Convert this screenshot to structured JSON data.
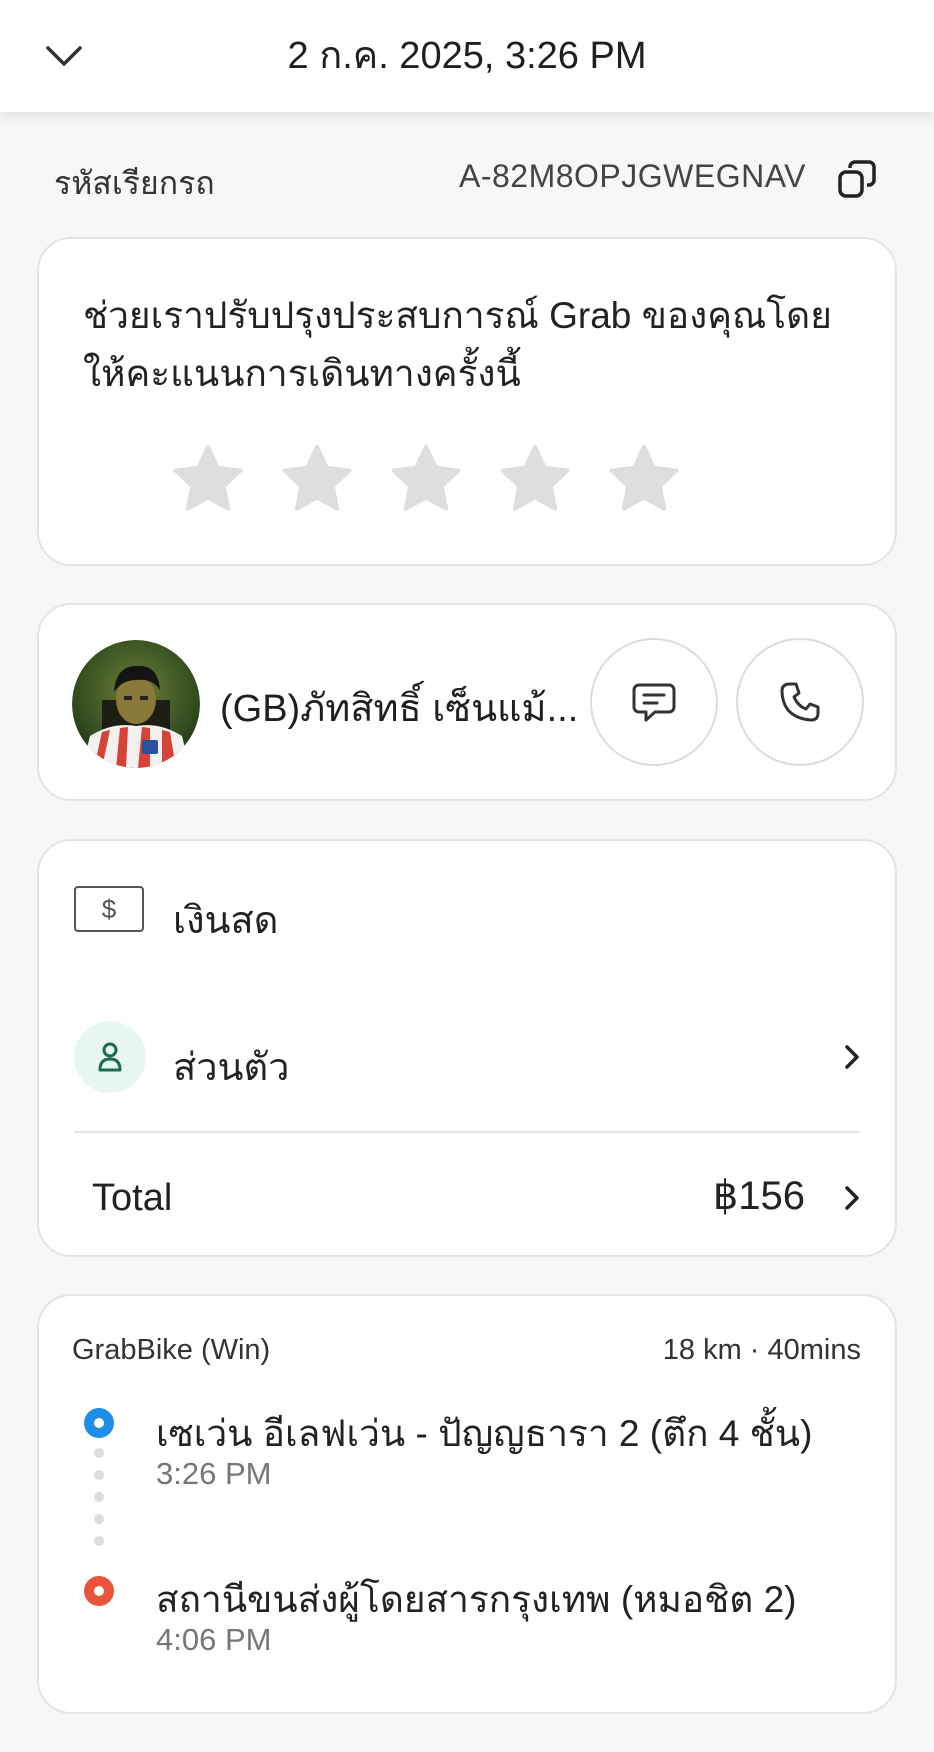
{
  "header": {
    "title": "2 ก.ค. 2025, 3:26 PM"
  },
  "booking": {
    "label": "รหัสเรียกรถ",
    "code": "A-82M8OPJGWEGNAV"
  },
  "rating": {
    "prompt": "ช่วยเราปรับปรุงประสบการณ์ Grab ของคุณโดยให้คะแนนการเดินทางครั้งนี้",
    "stars_total": 5,
    "stars_selected": 0
  },
  "driver": {
    "name": "(GB)ภัทสิทธิ์ เซ็นแม้..."
  },
  "payment": {
    "method": "เงินสด",
    "cash_symbol": "$",
    "profile": "ส่วนตัว",
    "total_label": "Total",
    "total_value": "฿156"
  },
  "trip": {
    "service": "GrabBike (Win)",
    "distance_duration": "18 km · 40mins",
    "pickup": {
      "name": "เซเว่น อีเลฟเว่น - ปัญญธารา 2 (ตึก 4 ชั้น)",
      "time": "3:26 PM"
    },
    "dropoff": {
      "name": "สถานีขนส่งผู้โดยสารกรุงเทพ (หมอชิต 2)",
      "time": "4:06 PM"
    }
  },
  "colors": {
    "pickup": "#1e8ee6",
    "dropoff": "#e9543b",
    "star_empty": "#dedede",
    "profile_icon_bg": "#e8f6f2",
    "profile_icon": "#1b6b55"
  }
}
